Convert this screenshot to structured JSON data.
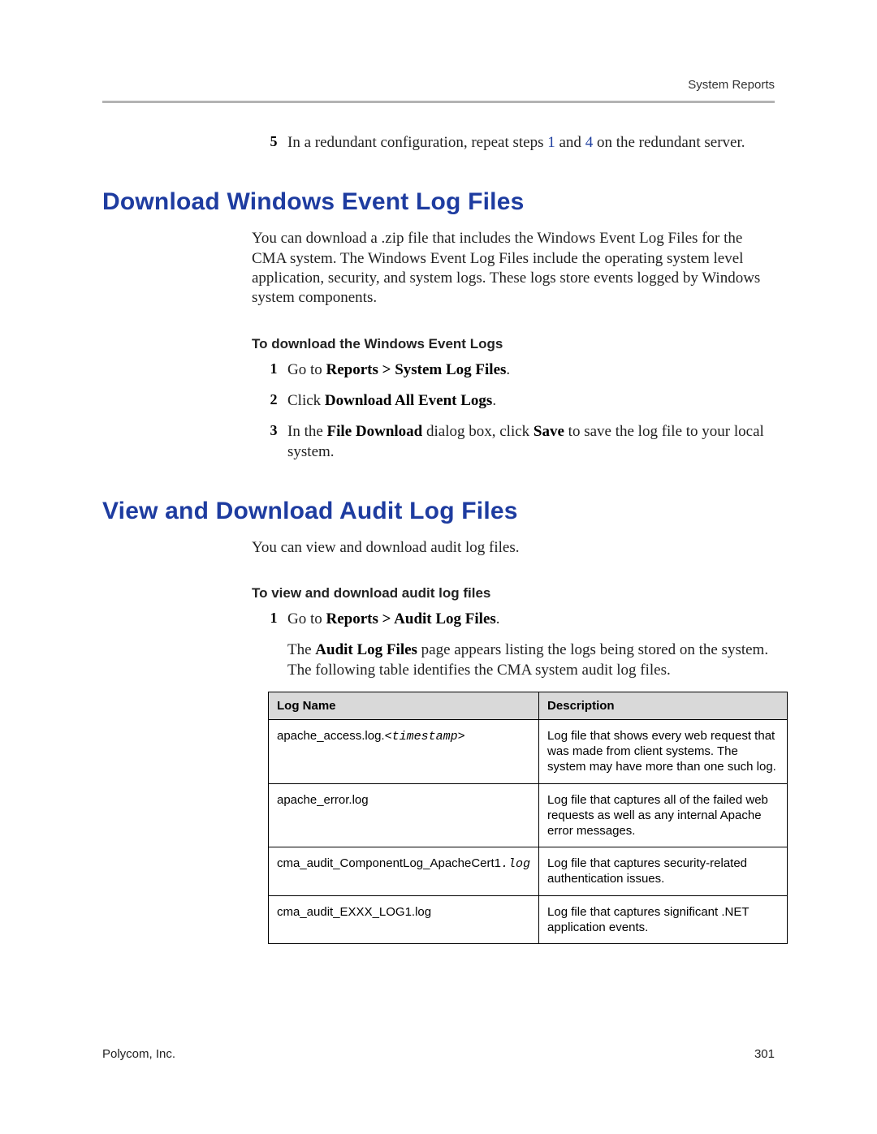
{
  "header": {
    "section": "System Reports"
  },
  "intro_step": {
    "num": "5",
    "pre": "In a redundant configuration, repeat steps ",
    "link1": "1",
    "mid": " and ",
    "link2": "4",
    "post": " on the redundant server."
  },
  "sec1": {
    "title": "Download Windows Event Log Files",
    "para": "You can download a .zip file that includes the Windows Event Log Files for the CMA system. The Windows Event Log Files include the operating system level application, security, and system logs. These logs store events logged by Windows system components.",
    "sub": "To download the Windows Event Logs",
    "steps": [
      {
        "num": "1",
        "pre": "Go to ",
        "b": "Reports > System Log Files",
        "post": "."
      },
      {
        "num": "2",
        "pre": "Click ",
        "b": "Download All Event Logs",
        "post": "."
      },
      {
        "num": "3",
        "pre": "In the ",
        "b1": "File Download",
        "mid": " dialog box, click ",
        "b2": "Save",
        "post": " to save the log file to your local system."
      }
    ]
  },
  "sec2": {
    "title": "View and Download Audit Log Files",
    "para": "You can view and download audit log files.",
    "sub": "To view and download audit log files",
    "step": {
      "num": "1",
      "pre": "Go to ",
      "b": "Reports > Audit Log Files",
      "post": "."
    },
    "after_pre": "The ",
    "after_b": "Audit Log Files",
    "after_post": " page appears listing the logs being stored on the system. The following table identifies the CMA system audit log files."
  },
  "table": {
    "h1": "Log Name",
    "h2": "Description",
    "rows": [
      {
        "name_plain": "apache_access.log.",
        "name_mono": "<timestamp>",
        "desc": "Log file that shows every web request that was made from client systems. The system may have more than one such log."
      },
      {
        "name_plain": "apache_error.log",
        "name_mono": "",
        "desc": "Log file that captures all of the failed web requests as well as any internal Apache error messages."
      },
      {
        "name_plain": "cma_audit_ComponentLog_ApacheCert1",
        "name_mono": ".log",
        "desc": "Log file that captures security-related authentication issues."
      },
      {
        "name_plain": "cma_audit_EXXX_LOG1.log",
        "name_mono": "",
        "desc": "Log file that captures significant .NET application events."
      }
    ]
  },
  "footer": {
    "company": "Polycom, Inc.",
    "page": "301"
  }
}
